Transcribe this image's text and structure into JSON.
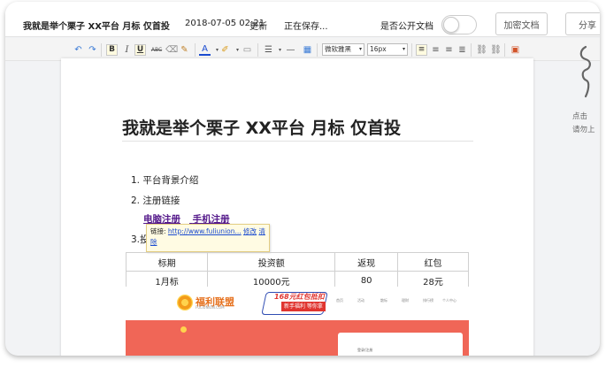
{
  "header": {
    "doc_title": "我就是举个栗子 XX平台 月标 仅首投",
    "date": "2018-07-05 02:21",
    "update_label": "更新",
    "saving_status": "正在保存...",
    "public_label": "是否公开文档",
    "public_on": false,
    "encrypt_button": "加密文档",
    "share_button": "分享"
  },
  "toolbar": {
    "icons": [
      "undo-icon",
      "redo-icon",
      "bold-icon",
      "italic-icon",
      "underline-icon",
      "strikethrough-icon",
      "eraser-icon",
      "format-brush-icon",
      "font-color-icon",
      "highlight-icon",
      "paste-icon",
      "line-height-icon",
      "horizontal-rule-icon",
      "table-icon",
      "align-left-icon",
      "align-center-icon",
      "align-right-icon",
      "align-justify-icon",
      "link-icon",
      "unlink-icon",
      "image-icon"
    ],
    "bold_glyph": "B",
    "italic_glyph": "I",
    "underline_glyph": "U",
    "strike_glyph": "ABC",
    "font_color_glyph": "A",
    "font_family": "微软雅黑",
    "font_size": "16px"
  },
  "document": {
    "heading": "我就是举个栗子 XX平台 月标 仅首投",
    "list": [
      {
        "num": "1.",
        "text": "平台背景介绍"
      },
      {
        "num": "2.",
        "text": "注册链接"
      }
    ],
    "links": [
      "电脑注册",
      "手机注册"
    ],
    "item3_prefix": "3.投",
    "link_tooltip": {
      "label": "链接:",
      "url": "http://www.fuliunion...",
      "edit": "修改",
      "clear": "清除"
    },
    "table": {
      "headers": [
        "标期",
        "投资额",
        "返现",
        "红包"
      ],
      "rows": [
        [
          "1月标",
          "10000元",
          "80",
          "28元"
        ]
      ]
    }
  },
  "embedded_image": {
    "logo_text": "福利联盟",
    "logo_sub": "FULIUNION.COM",
    "banner_line1": "168元红包抵扣",
    "banner_line2": "新手福利 等你拿",
    "nav": [
      "首页",
      "活动",
      "散标",
      "理财",
      "排行榜",
      "个人中心"
    ],
    "card_text": "登录/注册"
  },
  "side_hint": {
    "line1": "点击",
    "line2": "请勿上"
  }
}
